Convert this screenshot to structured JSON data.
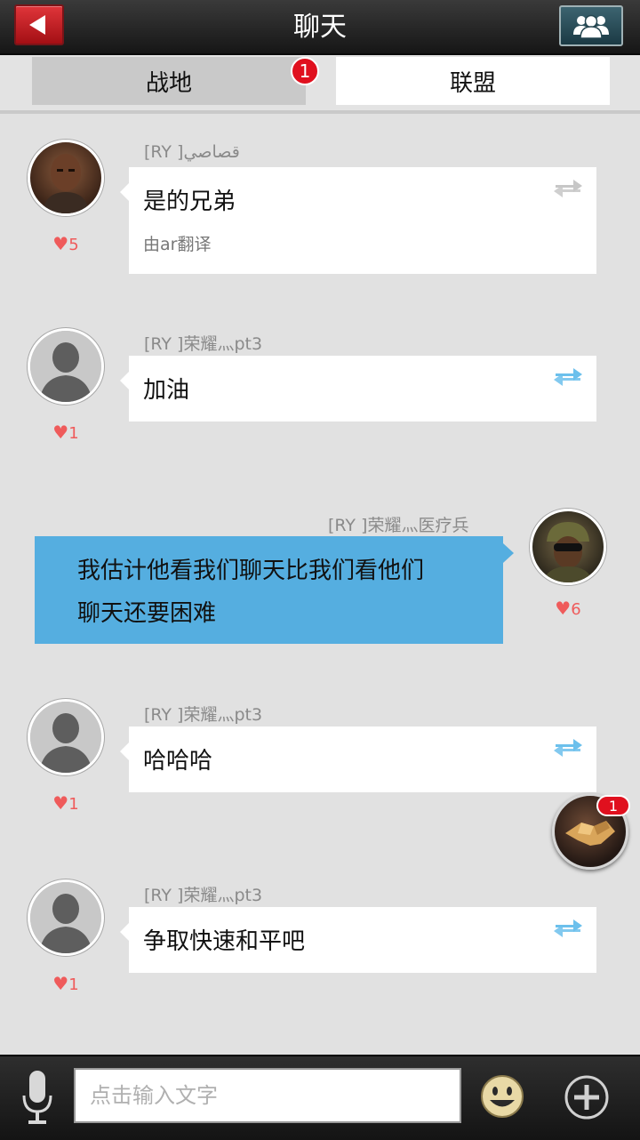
{
  "header": {
    "title": "聊天",
    "back_icon": "back-arrow-icon",
    "group_icon": "group-icon"
  },
  "tabs": [
    {
      "label": "战地",
      "selected": false,
      "badge": "1"
    },
    {
      "label": "联盟",
      "selected": true
    }
  ],
  "messages": [
    {
      "sender": "[RY ]قصاصي",
      "text": "是的兄弟",
      "subtext": "由ar翻译",
      "likes": "5",
      "avatar": "bald-soldier-avatar"
    },
    {
      "sender": "[RY ]荣耀灬pt3",
      "text": "加油",
      "likes": "1",
      "avatar": "default-silhouette-avatar"
    },
    {
      "sender": "[RY ]荣耀灬医疗兵",
      "lines": [
        "我估计他看我们聊天比我们看他们",
        "聊天还要困难"
      ],
      "likes": "6",
      "avatar": "helmet-soldier-avatar",
      "own": true
    },
    {
      "sender": "[RY ]荣耀灬pt3",
      "text": "哈哈哈",
      "likes": "1",
      "avatar": "default-silhouette-avatar"
    },
    {
      "sender": "[RY ]荣耀灬pt3",
      "text": "争取快速和平吧",
      "likes": "1",
      "avatar": "default-silhouette-avatar"
    }
  ],
  "floating_button": {
    "icon": "handshake-icon",
    "badge": "1"
  },
  "input_bar": {
    "placeholder": "点击输入文字",
    "value": "",
    "mic_icon": "microphone-icon",
    "emoji_icon": "smiley-icon",
    "plus_icon": "plus-circle-icon"
  },
  "colors": {
    "accent_blue": "#55aee0",
    "badge_red": "#e0101e",
    "like_red": "#ef5b5b"
  }
}
